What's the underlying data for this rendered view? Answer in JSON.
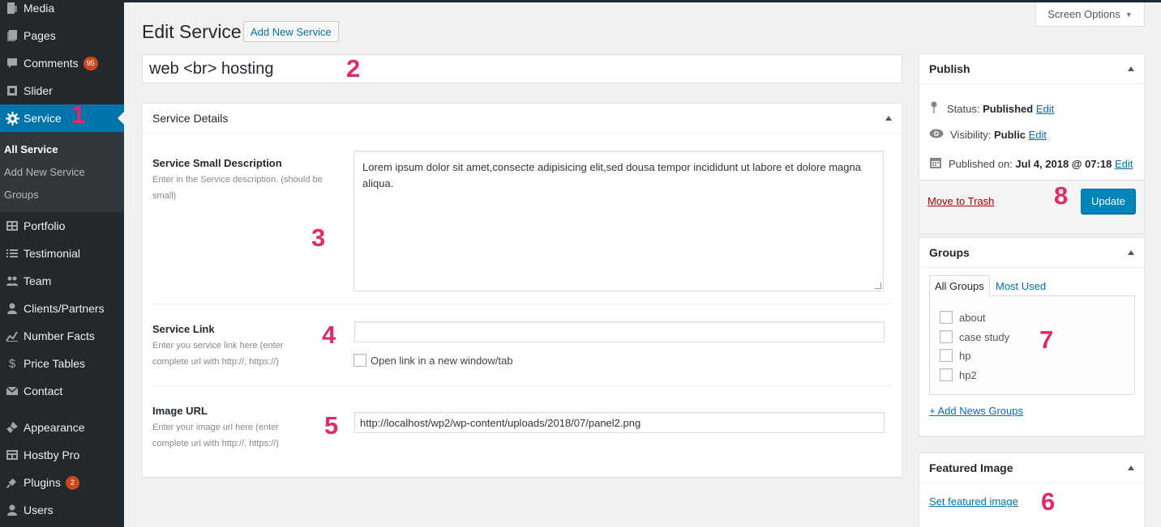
{
  "sidebar": {
    "items": [
      {
        "label": "Media",
        "icon": "media-icon"
      },
      {
        "label": "Pages",
        "icon": "pages-icon"
      },
      {
        "label": "Comments",
        "icon": "comments-icon",
        "badge": "95"
      },
      {
        "label": "Slider",
        "icon": "slider-icon"
      },
      {
        "label": "Service",
        "icon": "gear-icon",
        "active": true
      },
      {
        "label": "Portfolio",
        "icon": "portfolio-icon"
      },
      {
        "label": "Testimonial",
        "icon": "list-icon"
      },
      {
        "label": "Team",
        "icon": "team-icon"
      },
      {
        "label": "Clients/Partners",
        "icon": "user-icon"
      },
      {
        "label": "Number Facts",
        "icon": "chart-icon"
      },
      {
        "label": "Price Tables",
        "icon": "dollar-icon"
      },
      {
        "label": "Contact",
        "icon": "email-icon"
      },
      {
        "label": "Appearance",
        "icon": "brush-icon"
      },
      {
        "label": "Hostby Pro",
        "icon": "grid-icon"
      },
      {
        "label": "Plugins",
        "icon": "plugin-icon",
        "badge": "2"
      },
      {
        "label": "Users",
        "icon": "user-icon"
      }
    ],
    "submenu": [
      "All Service",
      "Add New Service",
      "Groups"
    ]
  },
  "header": {
    "screen_options": "Screen Options",
    "title": "Edit Service",
    "add_new": "Add New Service"
  },
  "post_title": "web <br> hosting",
  "details": {
    "heading": "Service Details",
    "small_desc_label": "Service Small Description",
    "small_desc_help": "Enter in the Service description. (should be small)",
    "small_desc_value": "Lorem ipsum dolor sit amet,consecte adipisicing elit,sed dousa tempor incididunt ut labore et dolore magna aliqua.",
    "link_label": "Service Link",
    "link_help": "Enter you service link here (enter complete url with http://, https://)",
    "link_value": "",
    "link_newtab": "Open link in a new window/tab",
    "image_label": "Image URL",
    "image_help": "Enter your image url here (enter complete url with http://, https://)",
    "image_value": "http://localhost/wp2/wp-content/uploads/2018/07/panel2.png"
  },
  "publish": {
    "heading": "Publish",
    "status_label": "Status:",
    "status_value": "Published",
    "visibility_label": "Visibility:",
    "visibility_value": "Public",
    "published_label": "Published on:",
    "published_value": "Jul 4, 2018 @ 07:18",
    "edit": "Edit",
    "trash": "Move to Trash",
    "update": "Update"
  },
  "groups": {
    "heading": "Groups",
    "tab_all": "All Groups",
    "tab_most": "Most Used",
    "items": [
      "about",
      "case study",
      "hp",
      "hp2"
    ],
    "add": "+ Add News Groups"
  },
  "featured": {
    "heading": "Featured Image",
    "set": "Set featured image"
  },
  "annotations": [
    "1",
    "2",
    "3",
    "4",
    "5",
    "6",
    "7",
    "8"
  ],
  "colors": {
    "accent": "#0073aa",
    "annotation": "#e02a6a",
    "sidebar": "#23282d",
    "badge": "#ca4a1f"
  }
}
